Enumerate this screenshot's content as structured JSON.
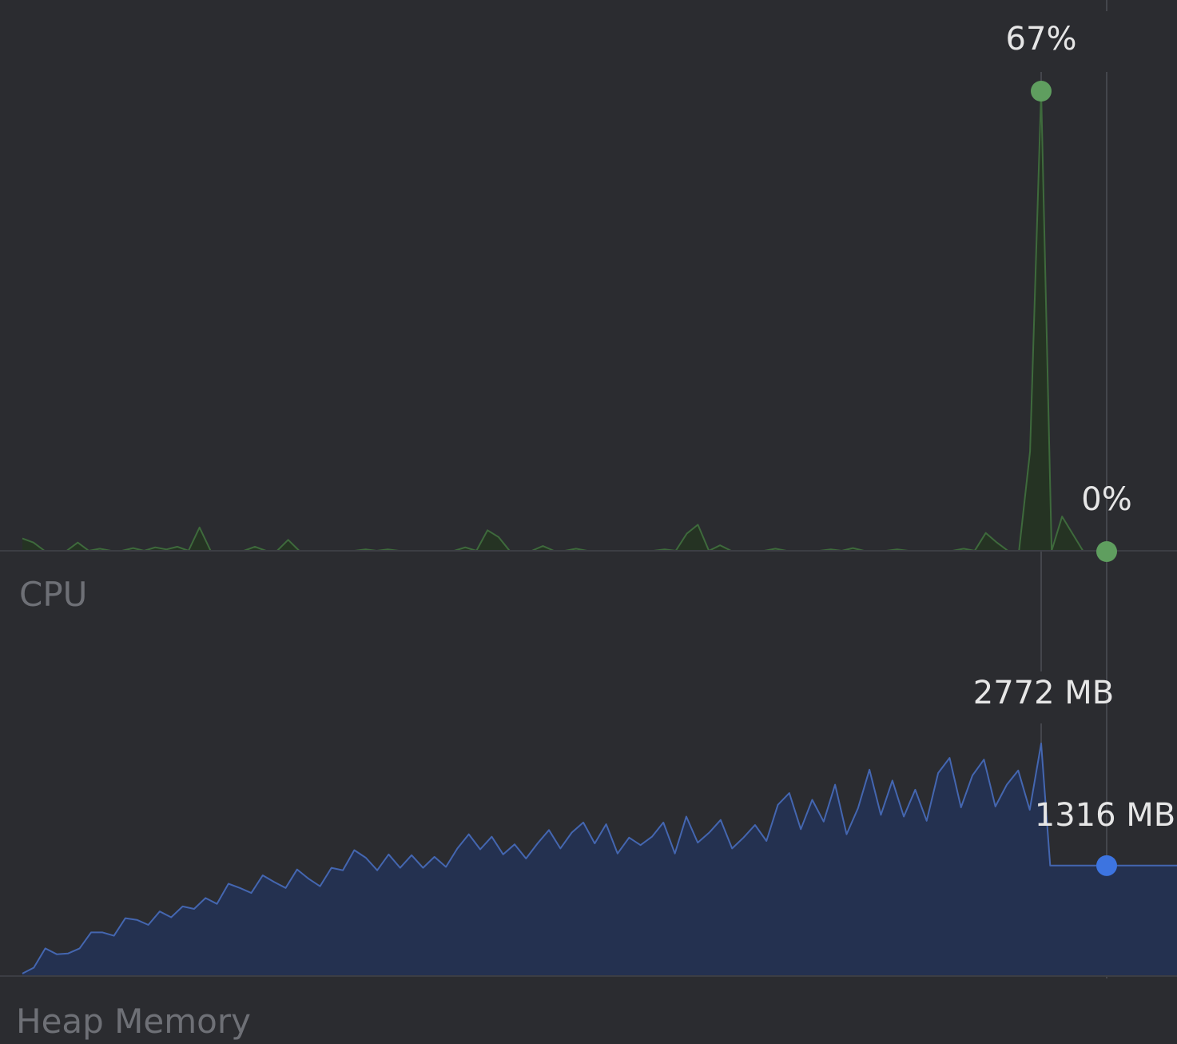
{
  "cpu": {
    "label": "CPU",
    "peak_label": "67%",
    "current_label": "0%",
    "unit": "%",
    "peak_value": 67,
    "current_value": 0,
    "y_max": 67,
    "series": [
      1.8,
      1.2,
      0,
      0,
      0,
      1.2,
      0,
      0.3,
      0,
      0,
      0.4,
      0,
      0.5,
      0.2,
      0.6,
      0,
      3.4,
      0,
      0,
      0,
      0,
      0.6,
      0,
      0,
      1.6,
      0,
      0,
      0,
      0,
      0,
      0,
      0.2,
      0,
      0.2,
      0,
      0,
      0,
      0,
      0,
      0,
      0.5,
      0,
      3.0,
      2.0,
      0,
      0,
      0,
      0.7,
      0,
      0,
      0.3,
      0,
      0,
      0,
      0,
      0,
      0,
      0,
      0.2,
      0,
      2.5,
      3.8,
      0,
      0.8,
      0,
      0,
      0,
      0,
      0.3,
      0,
      0,
      0,
      0,
      0.2,
      0,
      0.4,
      0,
      0,
      0,
      0.2,
      0,
      0,
      0,
      0,
      0,
      0.3,
      0,
      2.6,
      1.2,
      0,
      0,
      14.5,
      67,
      0,
      5.0,
      2.5,
      0,
      0,
      0,
      0,
      0,
      0,
      0,
      0,
      0,
      0
    ],
    "color": "#5f9e5f",
    "fill_color": "#253323"
  },
  "memory": {
    "label": "Heap Memory",
    "peak_label": "2772 MB",
    "current_label": "1316 MB",
    "unit": "MB",
    "peak_value": 2772,
    "current_value": 1316,
    "y_max": 2772,
    "series": [
      30,
      100,
      330,
      260,
      270,
      330,
      520,
      520,
      480,
      690,
      670,
      610,
      770,
      700,
      830,
      800,
      930,
      860,
      1100,
      1050,
      990,
      1200,
      1120,
      1050,
      1270,
      1160,
      1070,
      1290,
      1260,
      1500,
      1410,
      1260,
      1450,
      1290,
      1440,
      1290,
      1420,
      1300,
      1520,
      1690,
      1510,
      1660,
      1450,
      1570,
      1400,
      1580,
      1740,
      1520,
      1710,
      1830,
      1580,
      1810,
      1460,
      1650,
      1560,
      1660,
      1830,
      1460,
      1900,
      1590,
      1710,
      1860,
      1520,
      1650,
      1800,
      1610,
      2040,
      2180,
      1750,
      2100,
      1840,
      2280,
      1690,
      2000,
      2460,
      1920,
      2330,
      1900,
      2220,
      1850,
      2420,
      2600,
      2010,
      2390,
      2580,
      2020,
      2280,
      2450,
      1980,
      2772,
      1316,
      1316,
      1316,
      1316,
      1316,
      1316,
      1316,
      1316,
      1316,
      1316,
      1316,
      1316,
      1316,
      1316,
      1316
    ],
    "color": "#4466b0",
    "fill_color": "#243150",
    "marker_color": "#3d74e0"
  },
  "colors": {
    "background": "#2b2c30",
    "baseline": "#3c3e44",
    "cursor_line": "#44464c"
  }
}
